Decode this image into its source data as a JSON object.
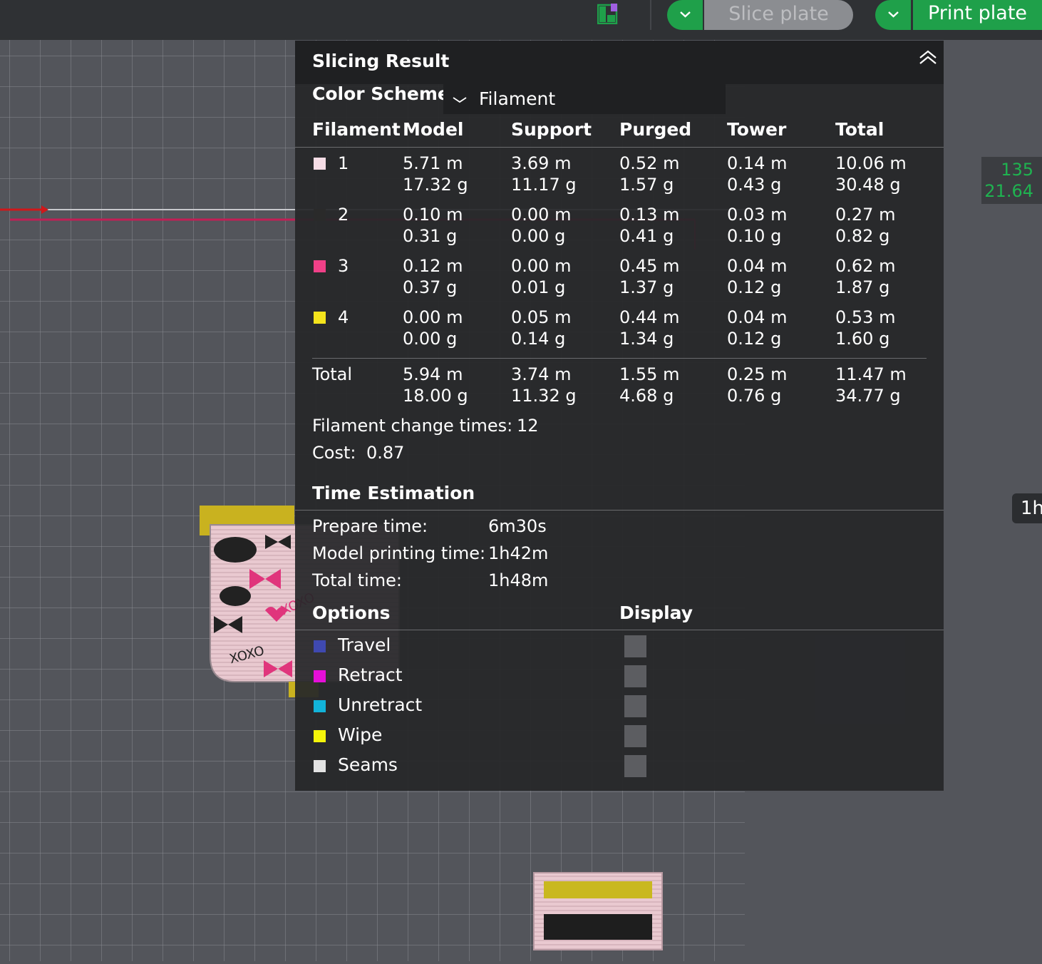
{
  "toolbar": {
    "slice_label": "Slice plate",
    "print_label": "Print plate"
  },
  "viewport": {
    "coord_line1": "135",
    "coord_line2": "21.64",
    "time_tag": "1h"
  },
  "panel": {
    "title": "Slicing Result",
    "color_scheme_label": "Color Scheme",
    "color_scheme_value": "Filament",
    "columns": [
      "Filament",
      "Model",
      "Support",
      "Purged",
      "Tower",
      "Total"
    ],
    "rows": [
      {
        "id": "1",
        "color": "#f6dde6",
        "model": [
          "5.71 m",
          "17.32 g"
        ],
        "support": [
          "3.69 m",
          "11.17 g"
        ],
        "purged": [
          "0.52 m",
          "1.57 g"
        ],
        "tower": [
          "0.14 m",
          "0.43 g"
        ],
        "total": [
          "10.06 m",
          "30.48 g"
        ]
      },
      {
        "id": "2",
        "color": "#2a2a2a",
        "model": [
          "0.10 m",
          "0.31 g"
        ],
        "support": [
          "0.00 m",
          "0.00 g"
        ],
        "purged": [
          "0.13 m",
          "0.41 g"
        ],
        "tower": [
          "0.03 m",
          "0.10 g"
        ],
        "total": [
          "0.27 m",
          "0.82 g"
        ]
      },
      {
        "id": "3",
        "color": "#f04088",
        "model": [
          "0.12 m",
          "0.37 g"
        ],
        "support": [
          "0.00 m",
          "0.01 g"
        ],
        "purged": [
          "0.45 m",
          "1.37 g"
        ],
        "tower": [
          "0.04 m",
          "0.12 g"
        ],
        "total": [
          "0.62 m",
          "1.87 g"
        ]
      },
      {
        "id": "4",
        "color": "#f4e41c",
        "model": [
          "0.00 m",
          "0.00 g"
        ],
        "support": [
          "0.05 m",
          "0.14 g"
        ],
        "purged": [
          "0.44 m",
          "1.34 g"
        ],
        "tower": [
          "0.04 m",
          "0.12 g"
        ],
        "total": [
          "0.53 m",
          "1.60 g"
        ]
      }
    ],
    "totals": {
      "label": "Total",
      "model": [
        "5.94 m",
        "18.00 g"
      ],
      "support": [
        "3.74 m",
        "11.32 g"
      ],
      "purged": [
        "1.55 m",
        "4.68 g"
      ],
      "tower": [
        "0.25 m",
        "0.76 g"
      ],
      "total": [
        "11.47 m",
        "34.77 g"
      ]
    },
    "change_times_label": "Filament change times:",
    "change_times_value": "12",
    "cost_label": "Cost:",
    "cost_value": "0.87",
    "time_title": "Time Estimation",
    "times": [
      {
        "label": "Prepare time:",
        "value": "6m30s"
      },
      {
        "label": "Model printing time:",
        "value": "1h42m"
      },
      {
        "label": "Total time:",
        "value": "1h48m"
      }
    ],
    "options_title": "Options",
    "display_title": "Display",
    "options": [
      {
        "label": "Travel",
        "color": "#3f49b0"
      },
      {
        "label": "Retract",
        "color": "#e60fd8"
      },
      {
        "label": "Unretract",
        "color": "#12b3d9"
      },
      {
        "label": "Wipe",
        "color": "#f5f50a"
      },
      {
        "label": "Seams",
        "color": "#e3e3e3"
      }
    ]
  }
}
